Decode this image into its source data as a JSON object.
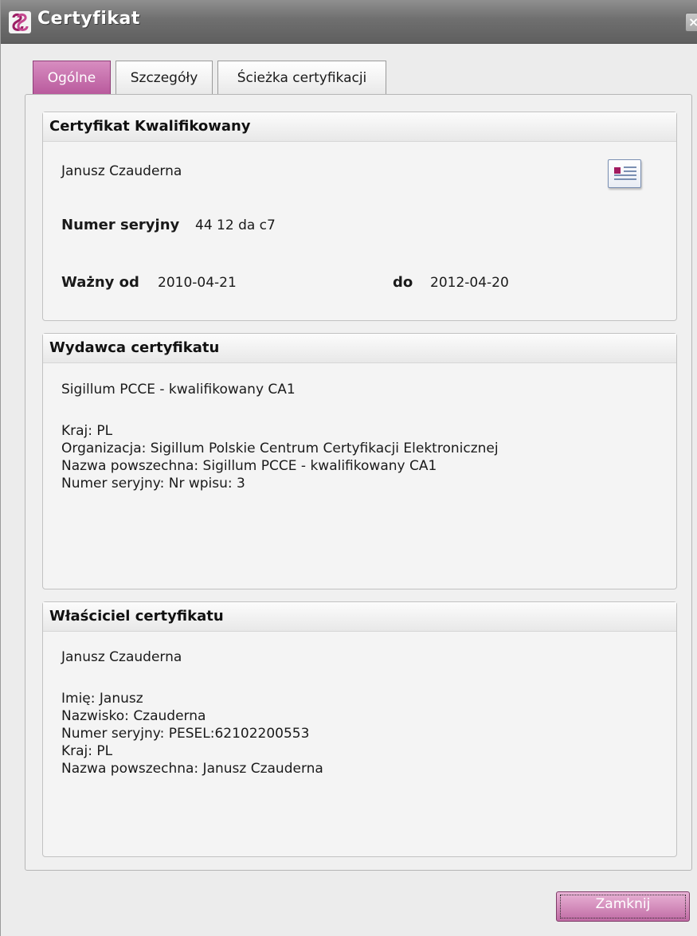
{
  "window": {
    "title": "Certyfikat",
    "close_glyph": "×"
  },
  "tabs": [
    {
      "label": "Ogólne",
      "active": true
    },
    {
      "label": "Szczegóły",
      "active": false
    },
    {
      "label": "Ścieżka certyfikacji",
      "active": false
    }
  ],
  "certificate": {
    "header": "Certyfikat Kwalifikowany",
    "owner_name": "Janusz Czauderna",
    "serial_label": "Numer seryjny",
    "serial_value": "44 12 da c7",
    "valid_from_label": "Ważny od",
    "valid_from": "2010-04-21",
    "valid_to_label": "do",
    "valid_to": "2012-04-20",
    "icon": "certificate-icon"
  },
  "issuer": {
    "header": "Wydawca certyfikatu",
    "name": "Sigillum PCCE - kwalifikowany CA1",
    "lines": [
      "Kraj: PL",
      "Organizacja: Sigillum Polskie Centrum Certyfikacji Elektronicznej",
      "Nazwa powszechna: Sigillum PCCE - kwalifikowany CA1",
      "Numer seryjny: Nr wpisu: 3"
    ]
  },
  "owner": {
    "header": "Właściciel certyfikatu",
    "name": "Janusz Czauderna",
    "lines": [
      "Imię: Janusz",
      "Nazwisko: Czauderna",
      "Numer seryjny: PESEL:62102200553",
      "Kraj: PL",
      "Nazwa powszechna: Janusz Czauderna"
    ]
  },
  "buttons": {
    "close_label": "Zamknij"
  },
  "colors": {
    "accent": "#b95a9d",
    "titlebar": "#6f6f6f"
  }
}
